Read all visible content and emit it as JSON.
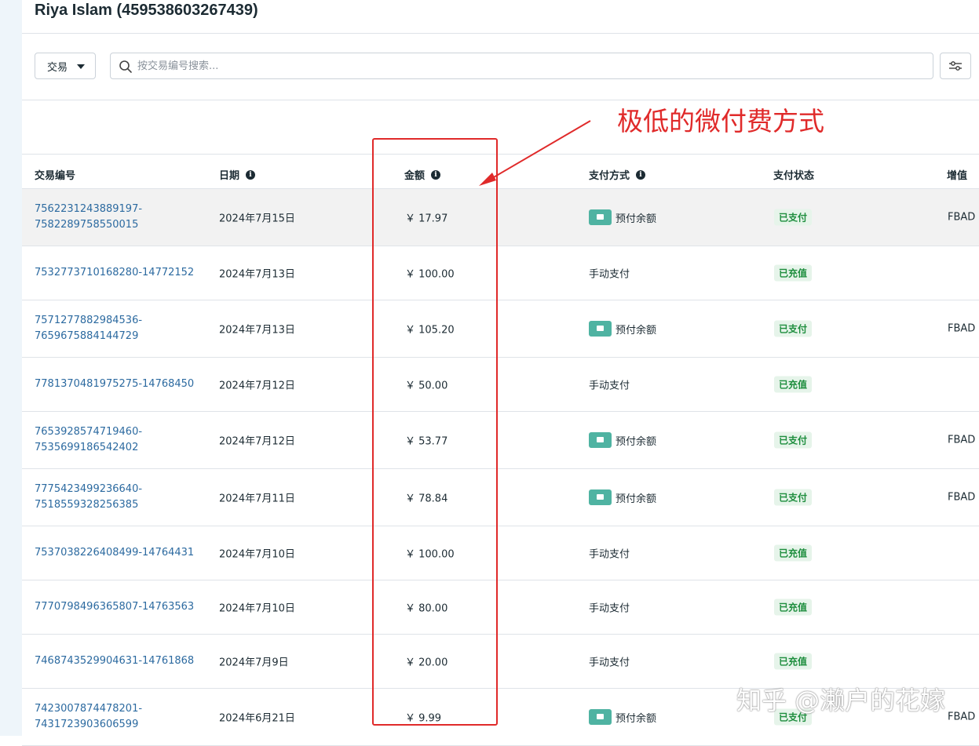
{
  "header": {
    "account_title": "Riya Islam (459538603267439)"
  },
  "toolbar": {
    "type_select": "交易",
    "search_placeholder": "按交易编号搜索...",
    "filter_icon": "filter-sliders-icon"
  },
  "columns": {
    "txn_id": "交易编号",
    "date": "日期",
    "amount": "金额",
    "method": "支付方式",
    "status": "支付状态",
    "extra": "增值"
  },
  "rows": [
    {
      "id_line1": "7562231243889197-",
      "id_line2": "7582289758550015",
      "date": "2024年7月15日",
      "amount": "￥ 17.97",
      "method": "预付余额",
      "status": "已支付",
      "extra": "FBAD",
      "highlighted": true
    },
    {
      "id_line1": "7532773710168280-14772152",
      "id_line2": "",
      "date": "2024年7月13日",
      "amount": "￥ 100.00",
      "method": "手动支付",
      "status": "已充值",
      "extra": ""
    },
    {
      "id_line1": "7571277882984536-",
      "id_line2": "7659675884144729",
      "date": "2024年7月13日",
      "amount": "￥ 105.20",
      "method": "预付余额",
      "status": "已支付",
      "extra": "FBAD"
    },
    {
      "id_line1": "7781370481975275-14768450",
      "id_line2": "",
      "date": "2024年7月12日",
      "amount": "￥ 50.00",
      "method": "手动支付",
      "status": "已充值",
      "extra": ""
    },
    {
      "id_line1": "7653928574719460-",
      "id_line2": "7535699186542402",
      "date": "2024年7月12日",
      "amount": "￥ 53.77",
      "method": "预付余额",
      "status": "已支付",
      "extra": "FBAD"
    },
    {
      "id_line1": "7775423499236640-",
      "id_line2": "7518559328256385",
      "date": "2024年7月11日",
      "amount": "￥ 78.84",
      "method": "预付余额",
      "status": "已支付",
      "extra": "FBAD"
    },
    {
      "id_line1": "7537038226408499-14764431",
      "id_line2": "",
      "date": "2024年7月10日",
      "amount": "￥ 100.00",
      "method": "手动支付",
      "status": "已充值",
      "extra": ""
    },
    {
      "id_line1": "7770798496365807-14763563",
      "id_line2": "",
      "date": "2024年7月10日",
      "amount": "￥ 80.00",
      "method": "手动支付",
      "status": "已充值",
      "extra": ""
    },
    {
      "id_line1": "7468743529904631-14761868",
      "id_line2": "",
      "date": "2024年7月9日",
      "amount": "￥ 20.00",
      "method": "手动支付",
      "status": "已充值",
      "extra": ""
    },
    {
      "id_line1": "7423007874478201-",
      "id_line2": "7431723903606599",
      "date": "2024年6月21日",
      "amount": "￥ 9.99",
      "method": "预付余额",
      "status": "已支付",
      "extra": "FBAD"
    }
  ],
  "annotation": {
    "text": "极低的微付费方式",
    "color": "#e02a2a"
  },
  "watermark": "知乎 @濑户的花嫁",
  "colors": {
    "link": "#2c6aa0",
    "status_badge_bg": "#e6f4ea",
    "status_badge_text": "#1e8e3e",
    "wallet_icon": "#4fb3a2"
  }
}
